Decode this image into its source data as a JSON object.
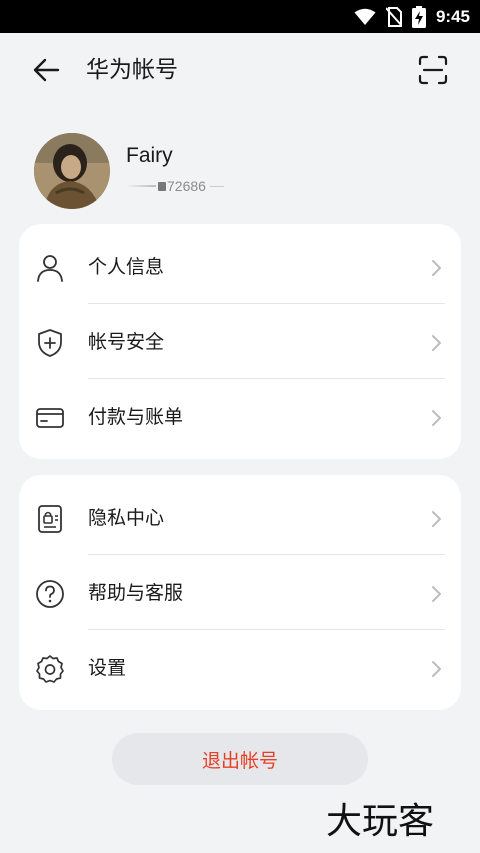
{
  "status_bar": {
    "time": "9:45",
    "icons": [
      "wifi-icon",
      "no-sim-icon",
      "battery-charging-icon"
    ]
  },
  "header": {
    "back_icon": "arrow-left-icon",
    "title": "华为帐号",
    "scan_icon": "scan-icon"
  },
  "profile": {
    "name": "Fairy",
    "id_visible": "72686"
  },
  "groups": [
    {
      "items": [
        {
          "icon": "person-icon",
          "label": "个人信息"
        },
        {
          "icon": "shield-plus-icon",
          "label": "帐号安全"
        },
        {
          "icon": "card-icon",
          "label": "付款与账单"
        }
      ]
    },
    {
      "items": [
        {
          "icon": "privacy-icon",
          "label": "隐私中心"
        },
        {
          "icon": "help-icon",
          "label": "帮助与客服"
        },
        {
          "icon": "gear-icon",
          "label": "设置"
        }
      ]
    }
  ],
  "logout": {
    "label": "退出帐号",
    "color": "#e84026"
  },
  "watermark": "大玩客",
  "colors": {
    "background": "#f1f3f5",
    "card": "#ffffff",
    "accent_red": "#e84026"
  }
}
